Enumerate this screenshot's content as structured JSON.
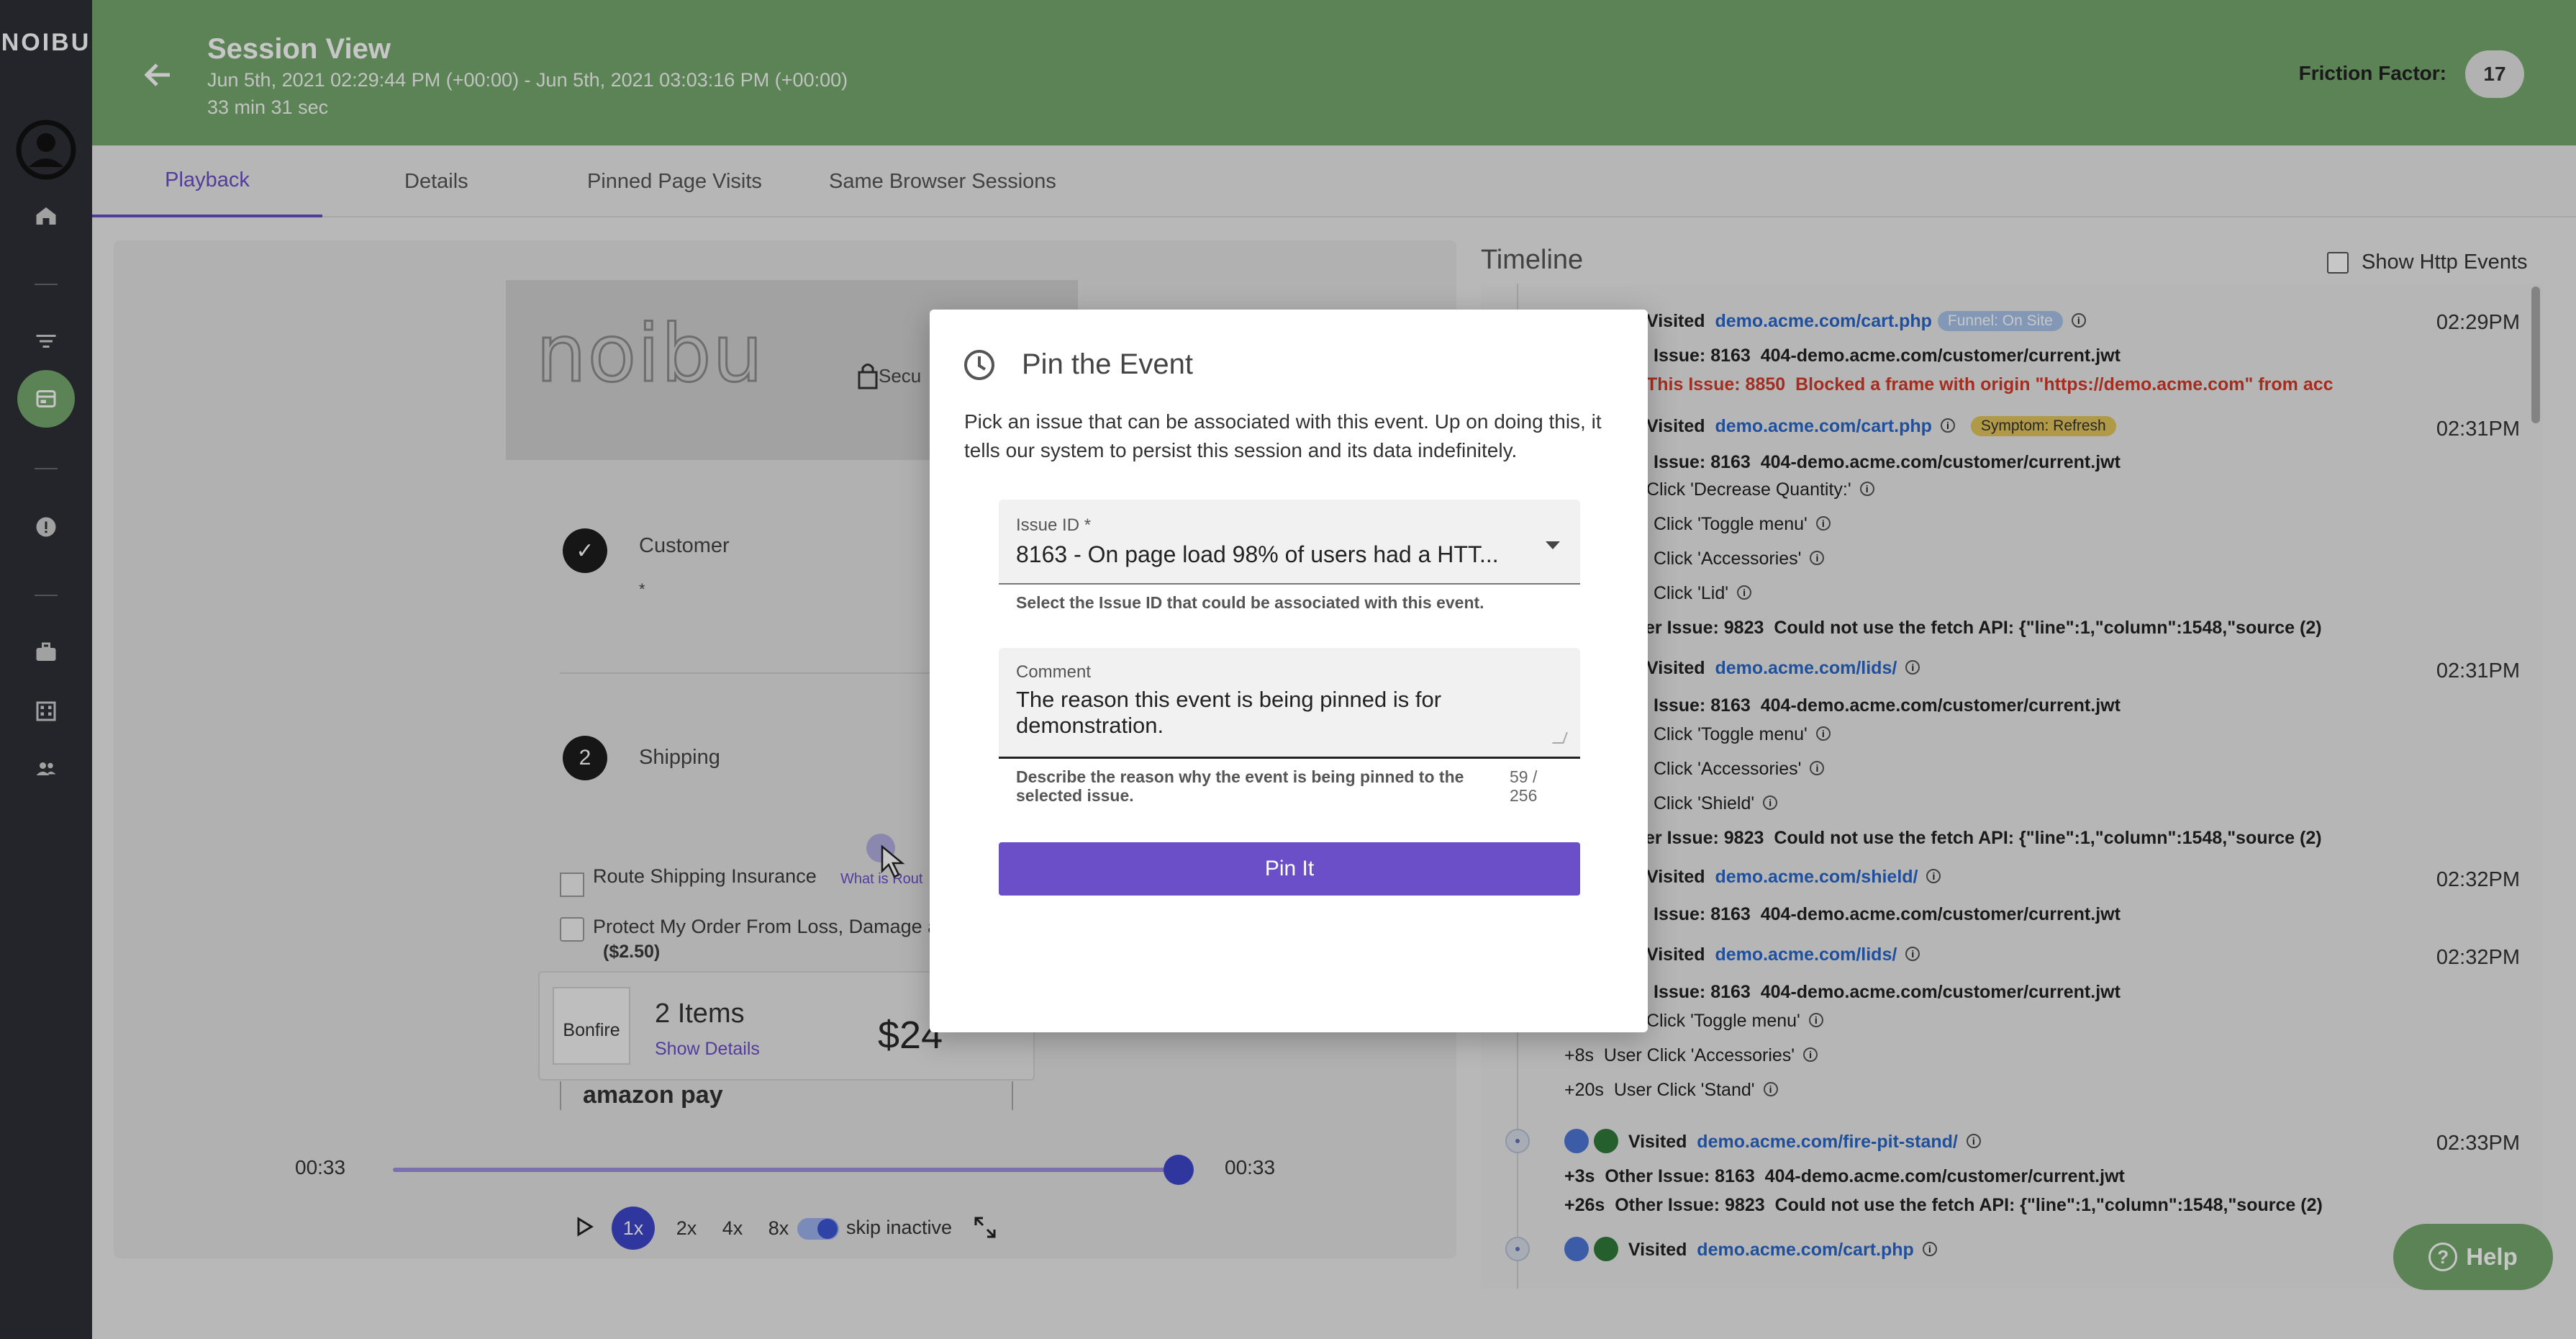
{
  "nav": {
    "logo": "NOIBU"
  },
  "header": {
    "title": "Session View",
    "date_range": "Jun 5th, 2021 02:29:44 PM (+00:00) - Jun 5th, 2021 03:03:16 PM (+00:00)",
    "duration": "33 min 31 sec",
    "friction_label": "Friction Factor:",
    "friction_value": "17"
  },
  "tabs": [
    "Playback",
    "Details",
    "Pinned Page Visits",
    "Same Browser Sessions"
  ],
  "replay": {
    "logo": "noibu",
    "secure": "Secu",
    "step1_number": "✓",
    "step1_label": "Customer",
    "step1_value": "*",
    "step2_number": "2",
    "step2_label": "Shipping",
    "route_label": "Route Shipping Insurance",
    "route_link": "What is Rout",
    "protect_label": "Protect My Order From Loss, Damage a",
    "protect_price": "($2.50)",
    "summary_img_alt": "Bonfire",
    "summary_items": "2 Items",
    "summary_details": "Show Details",
    "summary_price": "$24",
    "amazon_pay": "amazon pay"
  },
  "player": {
    "time_left": "00:33",
    "time_right": "00:33",
    "progress": 1.0,
    "speeds": [
      "1x",
      "2x",
      "4x",
      "8x"
    ],
    "selected_speed": "1x",
    "skip_label": "skip inactive",
    "skip_enabled": true
  },
  "timeline": {
    "title": "Timeline",
    "show_http_label": "Show Http Events",
    "show_http_checked": false,
    "rows": {
      "r1_prefix": "Visited",
      "r1_link": "demo.acme.com/cart.php",
      "r1_chip": "Funnel: On Site",
      "r1_time": "02:29PM",
      "r2_prefix": "Issue: 8163",
      "r2_text": "404-demo.acme.com/customer/current.jwt",
      "r3_prefix": "This Issue: 8850",
      "r3_text": "Blocked a frame with origin \"https://demo.acme.com\" from acc",
      "r4_prefix": "Visited",
      "r4_link": "demo.acme.com/cart.php",
      "r4_chip": "Symptom: Refresh",
      "r4_time": "02:31PM",
      "r5_prefix": "Issue: 8163",
      "r5_text": "404-demo.acme.com/customer/current.jwt",
      "r6_text": "Click 'Decrease Quantity:'",
      "r7_text": "Click 'Toggle menu'",
      "r8_text": "Click 'Accessories'",
      "r9_text": "Click 'Lid'",
      "r10_prefix": "er Issue: 9823",
      "r10_text": "Could not use the fetch API: {\"line\":1,\"column\":1548,\"source (2)",
      "r11_prefix": "Visited",
      "r11_link": "demo.acme.com/lids/",
      "r11_time": "02:31PM",
      "r12_prefix": "Issue: 8163",
      "r12_text": "404-demo.acme.com/customer/current.jwt",
      "r13_text": "Click 'Toggle menu'",
      "r14_text": "Click 'Accessories'",
      "r15_text": "Click 'Shield'",
      "r16_prefix": "er Issue: 9823",
      "r16_text": "Could not use the fetch API: {\"line\":1,\"column\":1548,\"source (2)",
      "r17_prefix": "Visited",
      "r17_link": "demo.acme.com/shield/",
      "r17_time": "02:32PM",
      "r18_prefix": "Issue: 8163",
      "r18_text": "404-demo.acme.com/customer/current.jwt",
      "r19_prefix": "Visited",
      "r19_link": "demo.acme.com/lids/",
      "r19_time": "02:32PM",
      "r20_prefix": "Issue: 8163",
      "r20_text": "404-demo.acme.com/customer/current.jwt",
      "r21_text": "Click 'Toggle menu'",
      "r22_offset": "+8s",
      "r22_text": "User Click 'Accessories'",
      "r23_offset": "+20s",
      "r23_text": "User Click 'Stand'",
      "r24_prefix": "Visited",
      "r24_link": "demo.acme.com/fire-pit-stand/",
      "r24_time": "02:33PM",
      "r25_offset": "+3s",
      "r25_prefix": "Other Issue: 8163",
      "r25_text": "404-demo.acme.com/customer/current.jwt",
      "r26_offset": "+26s",
      "r26_prefix": "Other Issue: 9823",
      "r26_text": "Could not use the fetch API: {\"line\":1,\"column\":1548,\"source (2)",
      "r27_prefix": "Visited",
      "r27_link": "demo.acme.com/cart.php"
    }
  },
  "modal": {
    "title": "Pin the Event",
    "description": "Pick an issue that can be associated with this event. Up on doing this, it tells our system to persist this session and its data indefinitely.",
    "issue_label": "Issue ID *",
    "issue_value": "8163 - On page load 98% of users had a HTT...",
    "issue_help": "Select the Issue ID that could be associated with this event.",
    "comment_label": "Comment",
    "comment_value": "The reason this event is being pinned is for demonstration.",
    "comment_help": "Describe the reason why the event is being pinned to the selected issue.",
    "char_count": "59 / 256",
    "submit_label": "Pin It"
  },
  "help": {
    "label": "Help",
    "icon": "?"
  },
  "colors": {
    "header_green": "#75a86d",
    "accent_purple": "#6b4fc8",
    "link_blue": "#2a67c9",
    "error_red": "#d43a2a",
    "sidebar": "#2e3036"
  }
}
